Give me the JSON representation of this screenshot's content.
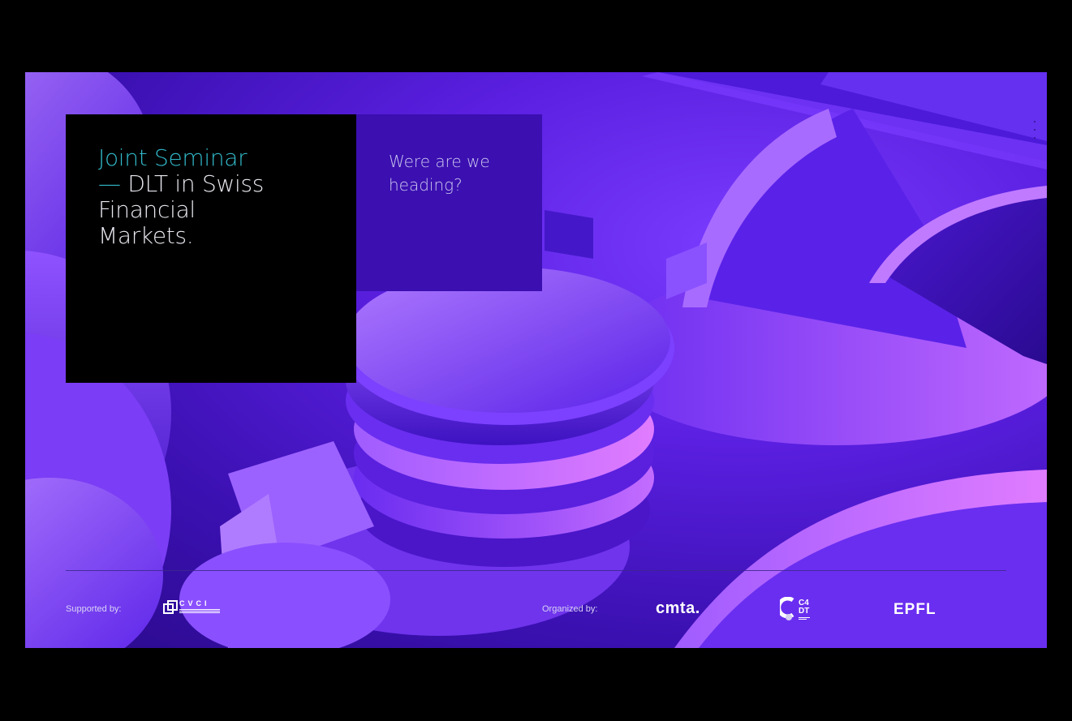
{
  "title": {
    "accent": "Joint Seminar",
    "dash": "—",
    "line1": "DLT in Swiss",
    "line2": "Financial",
    "line3": "Markets."
  },
  "question": "Were are we heading?",
  "footer": {
    "supported_label": "Supported by:",
    "organized_label": "Organized by:",
    "logos": {
      "cvci": "CVCI",
      "cmta": "cmta.",
      "c4dt_line1": "C4",
      "c4dt_line2": "DT",
      "epfl": "EPFL"
    }
  },
  "colors": {
    "accent": "#31b8c8",
    "title_card": "#000000",
    "question_card": "#3b0fb0",
    "background": "#5a1fe0"
  }
}
